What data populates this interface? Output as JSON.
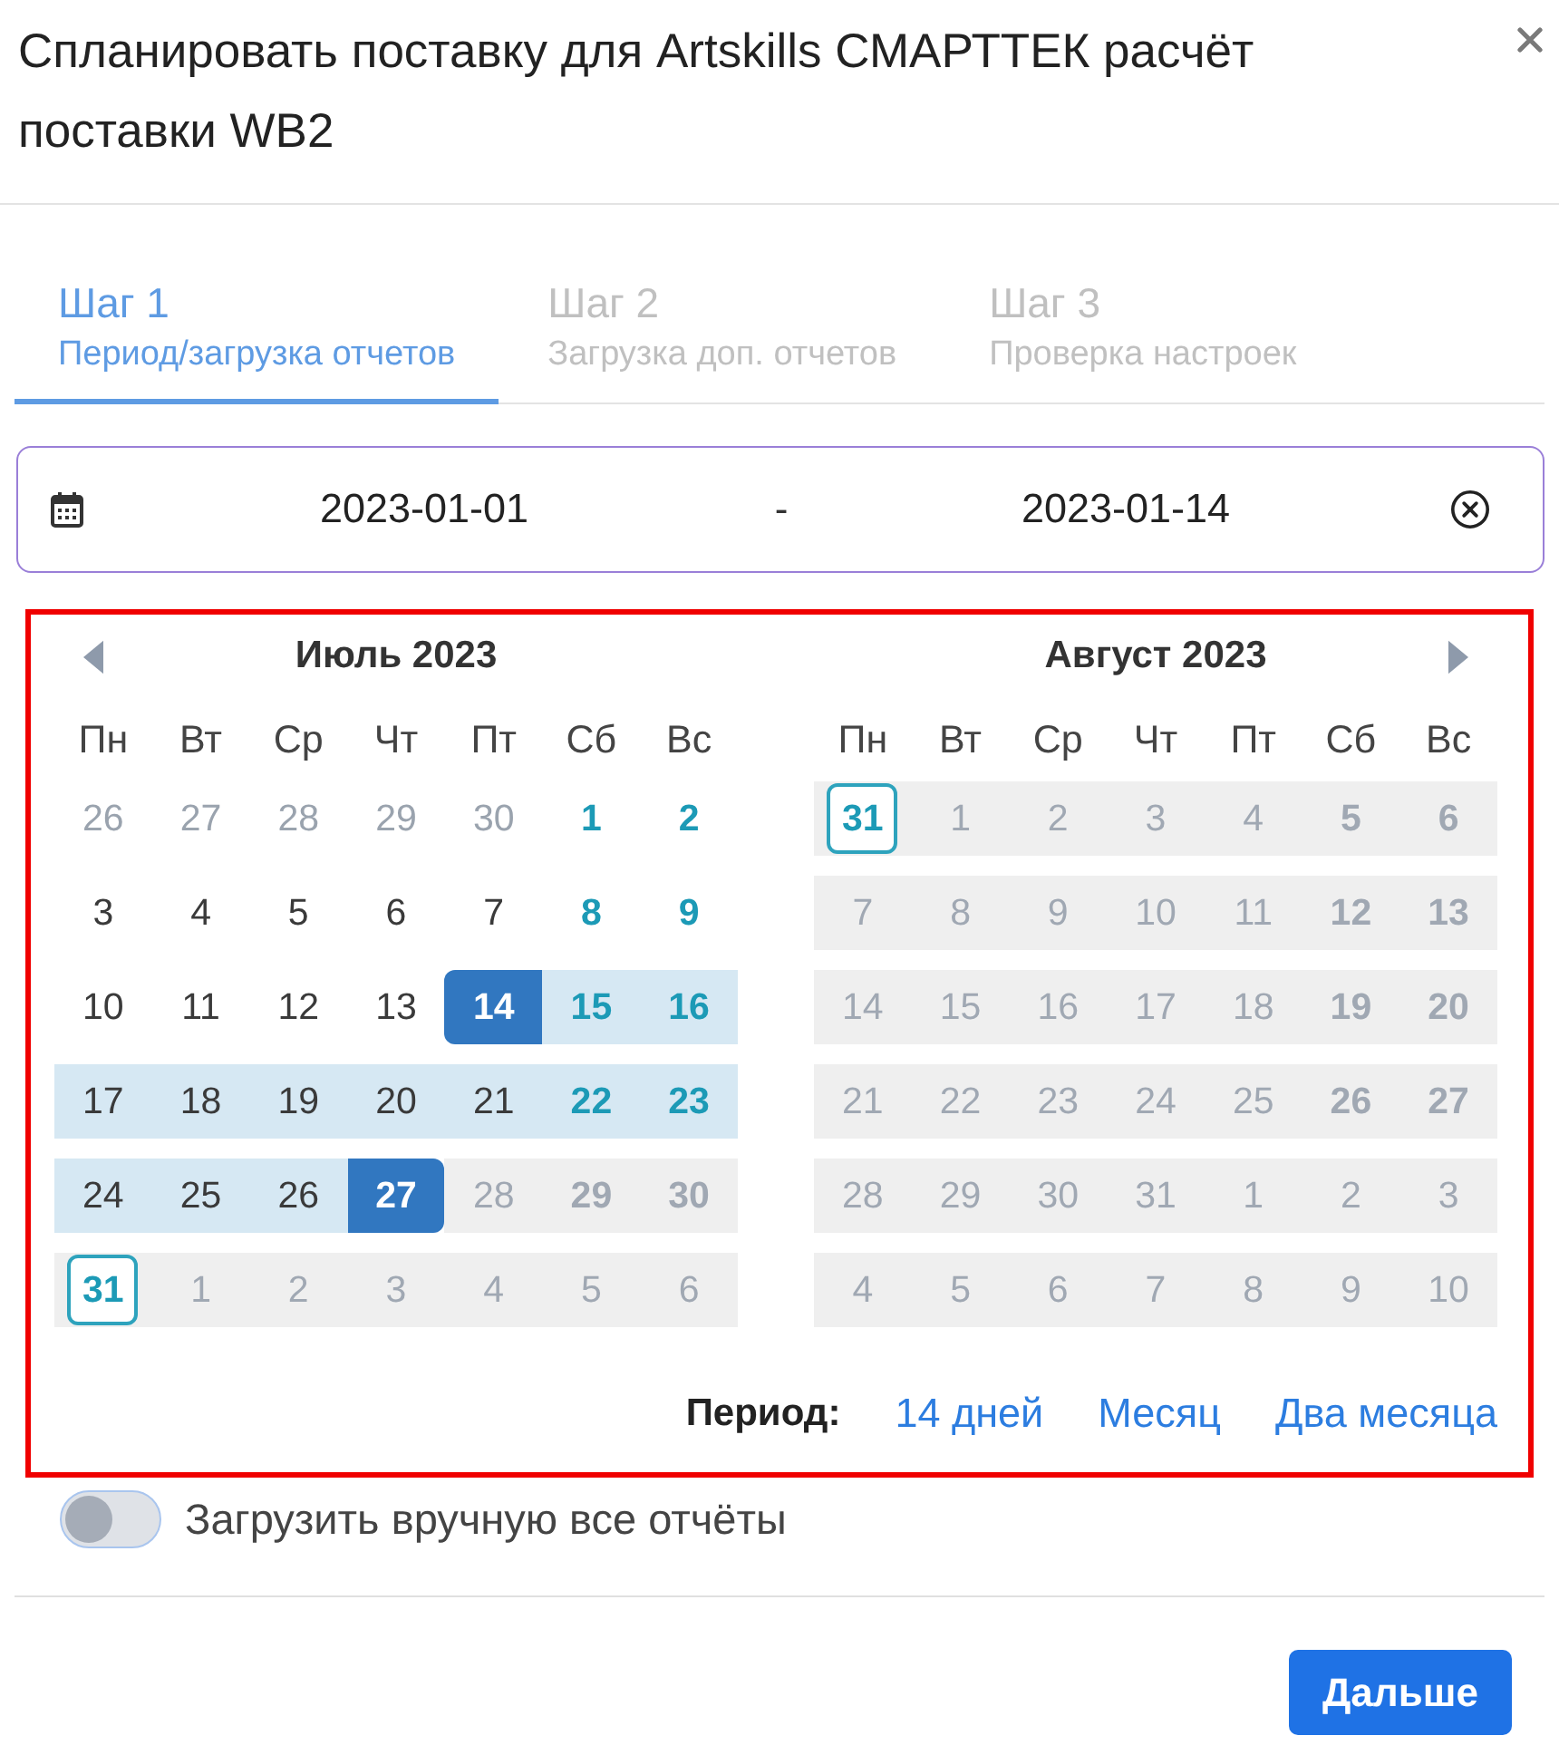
{
  "dialog": {
    "title": "Спланировать поставку для Artskills СМАРТТЕК расчёт поставки WB2"
  },
  "steps": [
    {
      "title": "Шаг 1",
      "subtitle": "Период/загрузка отчетов",
      "selected": true
    },
    {
      "title": "Шаг 2",
      "subtitle": "Загрузка доп. отчетов",
      "selected": false
    },
    {
      "title": "Шаг 3",
      "subtitle": "Проверка настроек",
      "selected": false
    }
  ],
  "date_range": {
    "start": "2023-01-01",
    "separator": "-",
    "end": "2023-01-14"
  },
  "calendar": {
    "months": [
      {
        "title": "Июль 2023",
        "weekdays": [
          "Пн",
          "Вт",
          "Ср",
          "Чт",
          "Пт",
          "Сб",
          "Вс"
        ],
        "weeks": [
          [
            {
              "day": "26",
              "kind": "outside",
              "selected": false,
              "in_range": false,
              "disabled": false,
              "today": false
            },
            {
              "day": "27",
              "kind": "outside",
              "selected": false,
              "in_range": false,
              "disabled": false,
              "today": false
            },
            {
              "day": "28",
              "kind": "outside",
              "selected": false,
              "in_range": false,
              "disabled": false,
              "today": false
            },
            {
              "day": "29",
              "kind": "outside",
              "selected": false,
              "in_range": false,
              "disabled": false,
              "today": false
            },
            {
              "day": "30",
              "kind": "outside",
              "selected": false,
              "in_range": false,
              "disabled": false,
              "today": false
            },
            {
              "day": "1",
              "kind": "weekend",
              "selected": false,
              "in_range": false,
              "disabled": false,
              "today": false
            },
            {
              "day": "2",
              "kind": "weekend",
              "selected": false,
              "in_range": false,
              "disabled": false,
              "today": false
            }
          ],
          [
            {
              "day": "3",
              "kind": "weekday",
              "selected": false,
              "in_range": false,
              "disabled": false,
              "today": false
            },
            {
              "day": "4",
              "kind": "weekday",
              "selected": false,
              "in_range": false,
              "disabled": false,
              "today": false
            },
            {
              "day": "5",
              "kind": "weekday",
              "selected": false,
              "in_range": false,
              "disabled": false,
              "today": false
            },
            {
              "day": "6",
              "kind": "weekday",
              "selected": false,
              "in_range": false,
              "disabled": false,
              "today": false
            },
            {
              "day": "7",
              "kind": "weekday",
              "selected": false,
              "in_range": false,
              "disabled": false,
              "today": false
            },
            {
              "day": "8",
              "kind": "weekend",
              "selected": false,
              "in_range": false,
              "disabled": false,
              "today": false
            },
            {
              "day": "9",
              "kind": "weekend",
              "selected": false,
              "in_range": false,
              "disabled": false,
              "today": false
            }
          ],
          [
            {
              "day": "10",
              "kind": "weekday",
              "selected": false,
              "in_range": false,
              "disabled": false,
              "today": false
            },
            {
              "day": "11",
              "kind": "weekday",
              "selected": false,
              "in_range": false,
              "disabled": false,
              "today": false
            },
            {
              "day": "12",
              "kind": "weekday",
              "selected": false,
              "in_range": false,
              "disabled": false,
              "today": false
            },
            {
              "day": "13",
              "kind": "weekday",
              "selected": false,
              "in_range": false,
              "disabled": false,
              "today": false
            },
            {
              "day": "14",
              "kind": "weekday",
              "selected": true,
              "in_range": true,
              "disabled": false,
              "today": false
            },
            {
              "day": "15",
              "kind": "weekend",
              "selected": false,
              "in_range": true,
              "disabled": false,
              "today": false
            },
            {
              "day": "16",
              "kind": "weekend",
              "selected": false,
              "in_range": true,
              "disabled": false,
              "today": false
            }
          ],
          [
            {
              "day": "17",
              "kind": "weekday",
              "selected": false,
              "in_range": true,
              "disabled": false,
              "today": false
            },
            {
              "day": "18",
              "kind": "weekday",
              "selected": false,
              "in_range": true,
              "disabled": false,
              "today": false
            },
            {
              "day": "19",
              "kind": "weekday",
              "selected": false,
              "in_range": true,
              "disabled": false,
              "today": false
            },
            {
              "day": "20",
              "kind": "weekday",
              "selected": false,
              "in_range": true,
              "disabled": false,
              "today": false
            },
            {
              "day": "21",
              "kind": "weekday",
              "selected": false,
              "in_range": true,
              "disabled": false,
              "today": false
            },
            {
              "day": "22",
              "kind": "weekend",
              "selected": false,
              "in_range": true,
              "disabled": false,
              "today": false
            },
            {
              "day": "23",
              "kind": "weekend",
              "selected": false,
              "in_range": true,
              "disabled": false,
              "today": false
            }
          ],
          [
            {
              "day": "24",
              "kind": "weekday",
              "selected": false,
              "in_range": true,
              "disabled": false,
              "today": false
            },
            {
              "day": "25",
              "kind": "weekday",
              "selected": false,
              "in_range": true,
              "disabled": false,
              "today": false
            },
            {
              "day": "26",
              "kind": "weekday",
              "selected": false,
              "in_range": true,
              "disabled": false,
              "today": false
            },
            {
              "day": "27",
              "kind": "weekday",
              "selected": true,
              "in_range": true,
              "disabled": false,
              "today": false
            },
            {
              "day": "28",
              "kind": "weekday",
              "selected": false,
              "in_range": false,
              "disabled": true,
              "today": false
            },
            {
              "day": "29",
              "kind": "weekend",
              "selected": false,
              "in_range": false,
              "disabled": true,
              "today": false
            },
            {
              "day": "30",
              "kind": "weekend",
              "selected": false,
              "in_range": false,
              "disabled": true,
              "today": false
            }
          ],
          [
            {
              "day": "31",
              "kind": "weekday",
              "selected": false,
              "in_range": false,
              "disabled": true,
              "today": true
            },
            {
              "day": "1",
              "kind": "outside",
              "selected": false,
              "in_range": false,
              "disabled": true,
              "today": false
            },
            {
              "day": "2",
              "kind": "outside",
              "selected": false,
              "in_range": false,
              "disabled": true,
              "today": false
            },
            {
              "day": "3",
              "kind": "outside",
              "selected": false,
              "in_range": false,
              "disabled": true,
              "today": false
            },
            {
              "day": "4",
              "kind": "outside",
              "selected": false,
              "in_range": false,
              "disabled": true,
              "today": false
            },
            {
              "day": "5",
              "kind": "outside",
              "selected": false,
              "in_range": false,
              "disabled": true,
              "today": false
            },
            {
              "day": "6",
              "kind": "outside",
              "selected": false,
              "in_range": false,
              "disabled": true,
              "today": false
            }
          ]
        ]
      },
      {
        "title": "Август 2023",
        "weekdays": [
          "Пн",
          "Вт",
          "Ср",
          "Чт",
          "Пт",
          "Сб",
          "Вс"
        ],
        "weeks": [
          [
            {
              "day": "31",
              "kind": "outside",
              "selected": false,
              "in_range": false,
              "disabled": true,
              "today": true
            },
            {
              "day": "1",
              "kind": "weekday",
              "selected": false,
              "in_range": false,
              "disabled": true,
              "today": false
            },
            {
              "day": "2",
              "kind": "weekday",
              "selected": false,
              "in_range": false,
              "disabled": true,
              "today": false
            },
            {
              "day": "3",
              "kind": "weekday",
              "selected": false,
              "in_range": false,
              "disabled": true,
              "today": false
            },
            {
              "day": "4",
              "kind": "weekday",
              "selected": false,
              "in_range": false,
              "disabled": true,
              "today": false
            },
            {
              "day": "5",
              "kind": "weekend",
              "selected": false,
              "in_range": false,
              "disabled": true,
              "today": false
            },
            {
              "day": "6",
              "kind": "weekend",
              "selected": false,
              "in_range": false,
              "disabled": true,
              "today": false
            }
          ],
          [
            {
              "day": "7",
              "kind": "weekday",
              "selected": false,
              "in_range": false,
              "disabled": true,
              "today": false
            },
            {
              "day": "8",
              "kind": "weekday",
              "selected": false,
              "in_range": false,
              "disabled": true,
              "today": false
            },
            {
              "day": "9",
              "kind": "weekday",
              "selected": false,
              "in_range": false,
              "disabled": true,
              "today": false
            },
            {
              "day": "10",
              "kind": "weekday",
              "selected": false,
              "in_range": false,
              "disabled": true,
              "today": false
            },
            {
              "day": "11",
              "kind": "weekday",
              "selected": false,
              "in_range": false,
              "disabled": true,
              "today": false
            },
            {
              "day": "12",
              "kind": "weekend",
              "selected": false,
              "in_range": false,
              "disabled": true,
              "today": false
            },
            {
              "day": "13",
              "kind": "weekend",
              "selected": false,
              "in_range": false,
              "disabled": true,
              "today": false
            }
          ],
          [
            {
              "day": "14",
              "kind": "weekday",
              "selected": false,
              "in_range": false,
              "disabled": true,
              "today": false
            },
            {
              "day": "15",
              "kind": "weekday",
              "selected": false,
              "in_range": false,
              "disabled": true,
              "today": false
            },
            {
              "day": "16",
              "kind": "weekday",
              "selected": false,
              "in_range": false,
              "disabled": true,
              "today": false
            },
            {
              "day": "17",
              "kind": "weekday",
              "selected": false,
              "in_range": false,
              "disabled": true,
              "today": false
            },
            {
              "day": "18",
              "kind": "weekday",
              "selected": false,
              "in_range": false,
              "disabled": true,
              "today": false
            },
            {
              "day": "19",
              "kind": "weekend",
              "selected": false,
              "in_range": false,
              "disabled": true,
              "today": false
            },
            {
              "day": "20",
              "kind": "weekend",
              "selected": false,
              "in_range": false,
              "disabled": true,
              "today": false
            }
          ],
          [
            {
              "day": "21",
              "kind": "weekday",
              "selected": false,
              "in_range": false,
              "disabled": true,
              "today": false
            },
            {
              "day": "22",
              "kind": "weekday",
              "selected": false,
              "in_range": false,
              "disabled": true,
              "today": false
            },
            {
              "day": "23",
              "kind": "weekday",
              "selected": false,
              "in_range": false,
              "disabled": true,
              "today": false
            },
            {
              "day": "24",
              "kind": "weekday",
              "selected": false,
              "in_range": false,
              "disabled": true,
              "today": false
            },
            {
              "day": "25",
              "kind": "weekday",
              "selected": false,
              "in_range": false,
              "disabled": true,
              "today": false
            },
            {
              "day": "26",
              "kind": "weekend",
              "selected": false,
              "in_range": false,
              "disabled": true,
              "today": false
            },
            {
              "day": "27",
              "kind": "weekend",
              "selected": false,
              "in_range": false,
              "disabled": true,
              "today": false
            }
          ],
          [
            {
              "day": "28",
              "kind": "weekday",
              "selected": false,
              "in_range": false,
              "disabled": true,
              "today": false
            },
            {
              "day": "29",
              "kind": "weekday",
              "selected": false,
              "in_range": false,
              "disabled": true,
              "today": false
            },
            {
              "day": "30",
              "kind": "weekday",
              "selected": false,
              "in_range": false,
              "disabled": true,
              "today": false
            },
            {
              "day": "31",
              "kind": "weekday",
              "selected": false,
              "in_range": false,
              "disabled": true,
              "today": false
            },
            {
              "day": "1",
              "kind": "outside",
              "selected": false,
              "in_range": false,
              "disabled": true,
              "today": false
            },
            {
              "day": "2",
              "kind": "outside",
              "selected": false,
              "in_range": false,
              "disabled": true,
              "today": false
            },
            {
              "day": "3",
              "kind": "outside",
              "selected": false,
              "in_range": false,
              "disabled": true,
              "today": false
            }
          ],
          [
            {
              "day": "4",
              "kind": "outside",
              "selected": false,
              "in_range": false,
              "disabled": true,
              "today": false
            },
            {
              "day": "5",
              "kind": "outside",
              "selected": false,
              "in_range": false,
              "disabled": true,
              "today": false
            },
            {
              "day": "6",
              "kind": "outside",
              "selected": false,
              "in_range": false,
              "disabled": true,
              "today": false
            },
            {
              "day": "7",
              "kind": "outside",
              "selected": false,
              "in_range": false,
              "disabled": true,
              "today": false
            },
            {
              "day": "8",
              "kind": "outside",
              "selected": false,
              "in_range": false,
              "disabled": true,
              "today": false
            },
            {
              "day": "9",
              "kind": "outside",
              "selected": false,
              "in_range": false,
              "disabled": true,
              "today": false
            },
            {
              "day": "10",
              "kind": "outside",
              "selected": false,
              "in_range": false,
              "disabled": true,
              "today": false
            }
          ]
        ]
      }
    ],
    "period_label": "Период:",
    "period_options": [
      "14 дней",
      "Месяц",
      "Два месяца"
    ]
  },
  "manual_upload_toggle": {
    "label": "Загрузить вручную все отчёты",
    "on": false
  },
  "buttons": [
    "Дальше"
  ]
}
